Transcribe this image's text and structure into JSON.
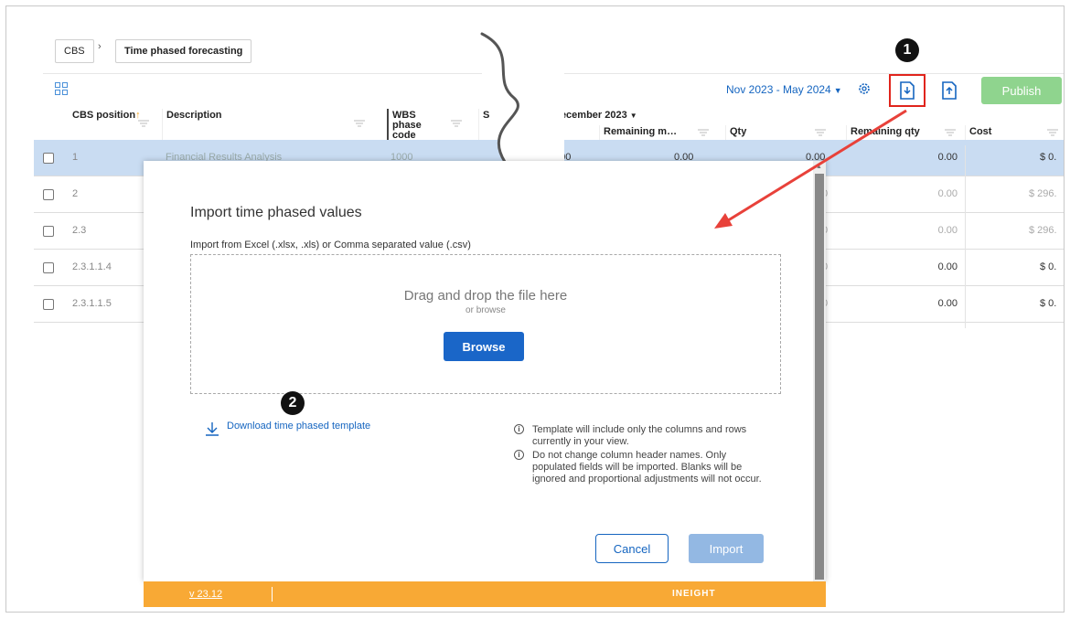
{
  "breadcrumb": {
    "root": "CBS",
    "separator": "›",
    "current": "Time phased forecasting"
  },
  "toolbar": {
    "date_range": "Nov 2023 - May 2024",
    "publish_label": "Publish",
    "icons": [
      "grid-view-icon",
      "gear-icon",
      "import-file-icon",
      "export-file-icon"
    ]
  },
  "table": {
    "columns": {
      "cbs_position": "CBS position",
      "description": "Description",
      "wbs_phase_code": "WBS phase code",
      "s_col": "S",
      "month": "December 2023",
      "remaining_m": "Remaining m…",
      "qty": "Qty",
      "remaining_qty": "Remaining qty",
      "cost": "Cost"
    },
    "rows": [
      {
        "cbs": "1",
        "description": "Financial Results Analysis",
        "wbs": "1000",
        "left_val": "0.00",
        "mid_val": "0.00",
        "qty": "0.00",
        "remaining_qty": "0.00",
        "cost": "$ 0."
      },
      {
        "cbs": "2",
        "description": "",
        "wbs": "",
        "left_val": "",
        "mid_val": "",
        "qty": "0",
        "remaining_qty": "0.00",
        "cost": "$ 296."
      },
      {
        "cbs": "2.3",
        "description": "",
        "wbs": "",
        "left_val": "",
        "mid_val": "",
        "qty": "0",
        "remaining_qty": "0.00",
        "cost": "$ 296."
      },
      {
        "cbs": "2.3.1.1.4",
        "description": "",
        "wbs": "",
        "left_val": "",
        "mid_val": "",
        "qty": "0",
        "remaining_qty": "0.00",
        "cost": "$ 0."
      },
      {
        "cbs": "2.3.1.1.5",
        "description": "",
        "wbs": "",
        "left_val": "",
        "mid_val": "",
        "qty": "0",
        "remaining_qty": "0.00",
        "cost": "$ 0."
      }
    ]
  },
  "modal": {
    "title": "Import time phased values",
    "subtitle": "Import from Excel (.xlsx, .xls) or Comma separated value (.csv)",
    "drop_title": "Drag and drop the file here",
    "drop_sub": "or browse",
    "browse_label": "Browse",
    "download_link": "Download time phased template",
    "info_1": "Template will include only the columns and rows currently in your view.",
    "info_2": "Do not change column header names. Only populated fields will be imported. Blanks will be ignored and proportional adjustments will not occur.",
    "cancel_label": "Cancel",
    "import_label": "Import"
  },
  "footer": {
    "version": "v 23.12",
    "brand": "INEIGHT"
  },
  "annotations": {
    "step1": "1",
    "step2": "2"
  },
  "colors": {
    "accent_blue": "#1a66c8",
    "publish_green": "#8fd48e",
    "footer_orange": "#f8a935",
    "highlight_red": "#e0241c",
    "selected_row": "#c9dcf2"
  }
}
